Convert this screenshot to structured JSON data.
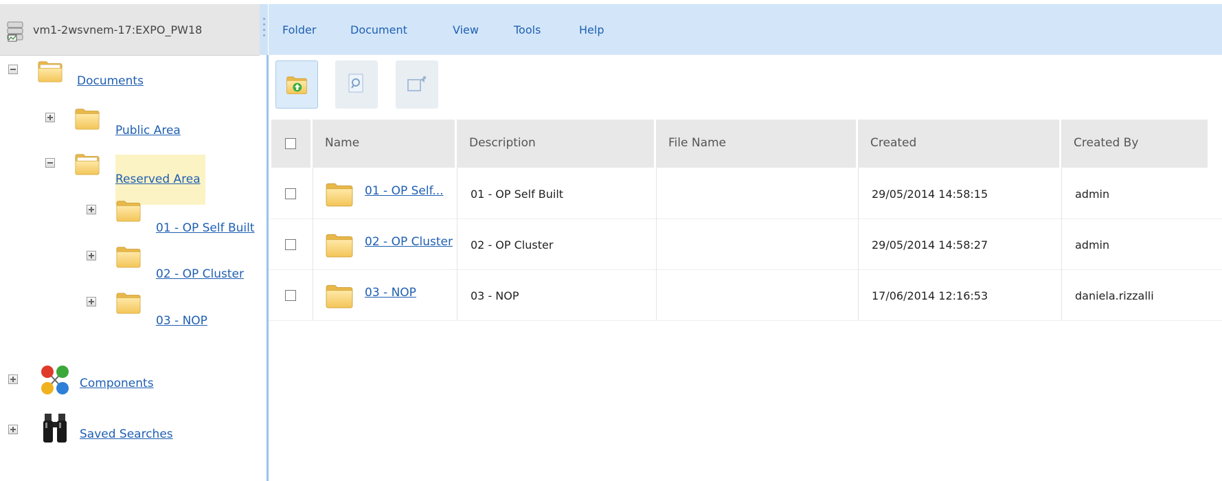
{
  "server": {
    "label": "vm1-2wsvnem-17:EXPO_PW18",
    "icon": "server-database-icon"
  },
  "menu": [
    "Folder",
    "Document",
    "View",
    "Tools",
    "Help"
  ],
  "toolbar": [
    {
      "icon": "folder-up-icon",
      "state": "active"
    },
    {
      "icon": "search-document-icon",
      "state": "disabled"
    },
    {
      "icon": "move-folder-icon",
      "state": "disabled"
    }
  ],
  "tree": {
    "documents": {
      "label": "Documents",
      "expanded": true
    },
    "public_area": {
      "label": "Public Area",
      "expanded": false
    },
    "reserved_area": {
      "label": "Reserved Area",
      "expanded": true,
      "selected": true
    },
    "items": [
      {
        "label": "01 - OP Self Built"
      },
      {
        "label": "02 - OP Cluster"
      },
      {
        "label": "03 - NOP"
      }
    ],
    "components": {
      "label": "Components",
      "icon": "components-network-icon"
    },
    "saved_searches": {
      "label": "Saved Searches",
      "icon": "binoculars-icon"
    }
  },
  "grid": {
    "columns": [
      "Name",
      "Description",
      "File Name",
      "Created",
      "Created By"
    ],
    "rows": [
      {
        "name": "01 - OP Self...",
        "description": "01 - OP Self Built",
        "file_name": "",
        "created": "29/05/2014 14:58:15",
        "created_by": "admin"
      },
      {
        "name": "02 - OP Cluster",
        "description": "02 - OP Cluster",
        "file_name": "",
        "created": "29/05/2014 14:58:27",
        "created_by": "admin"
      },
      {
        "name": "03 - NOP",
        "description": "03 - NOP",
        "file_name": "",
        "created": "17/06/2014 12:16:53",
        "created_by": "daniela.rizzalli"
      }
    ]
  },
  "colors": {
    "menubar": "#d3e6f9",
    "link": "#1f5fb3",
    "selection": "#fcf3c4",
    "header": "#e8e8e8"
  }
}
